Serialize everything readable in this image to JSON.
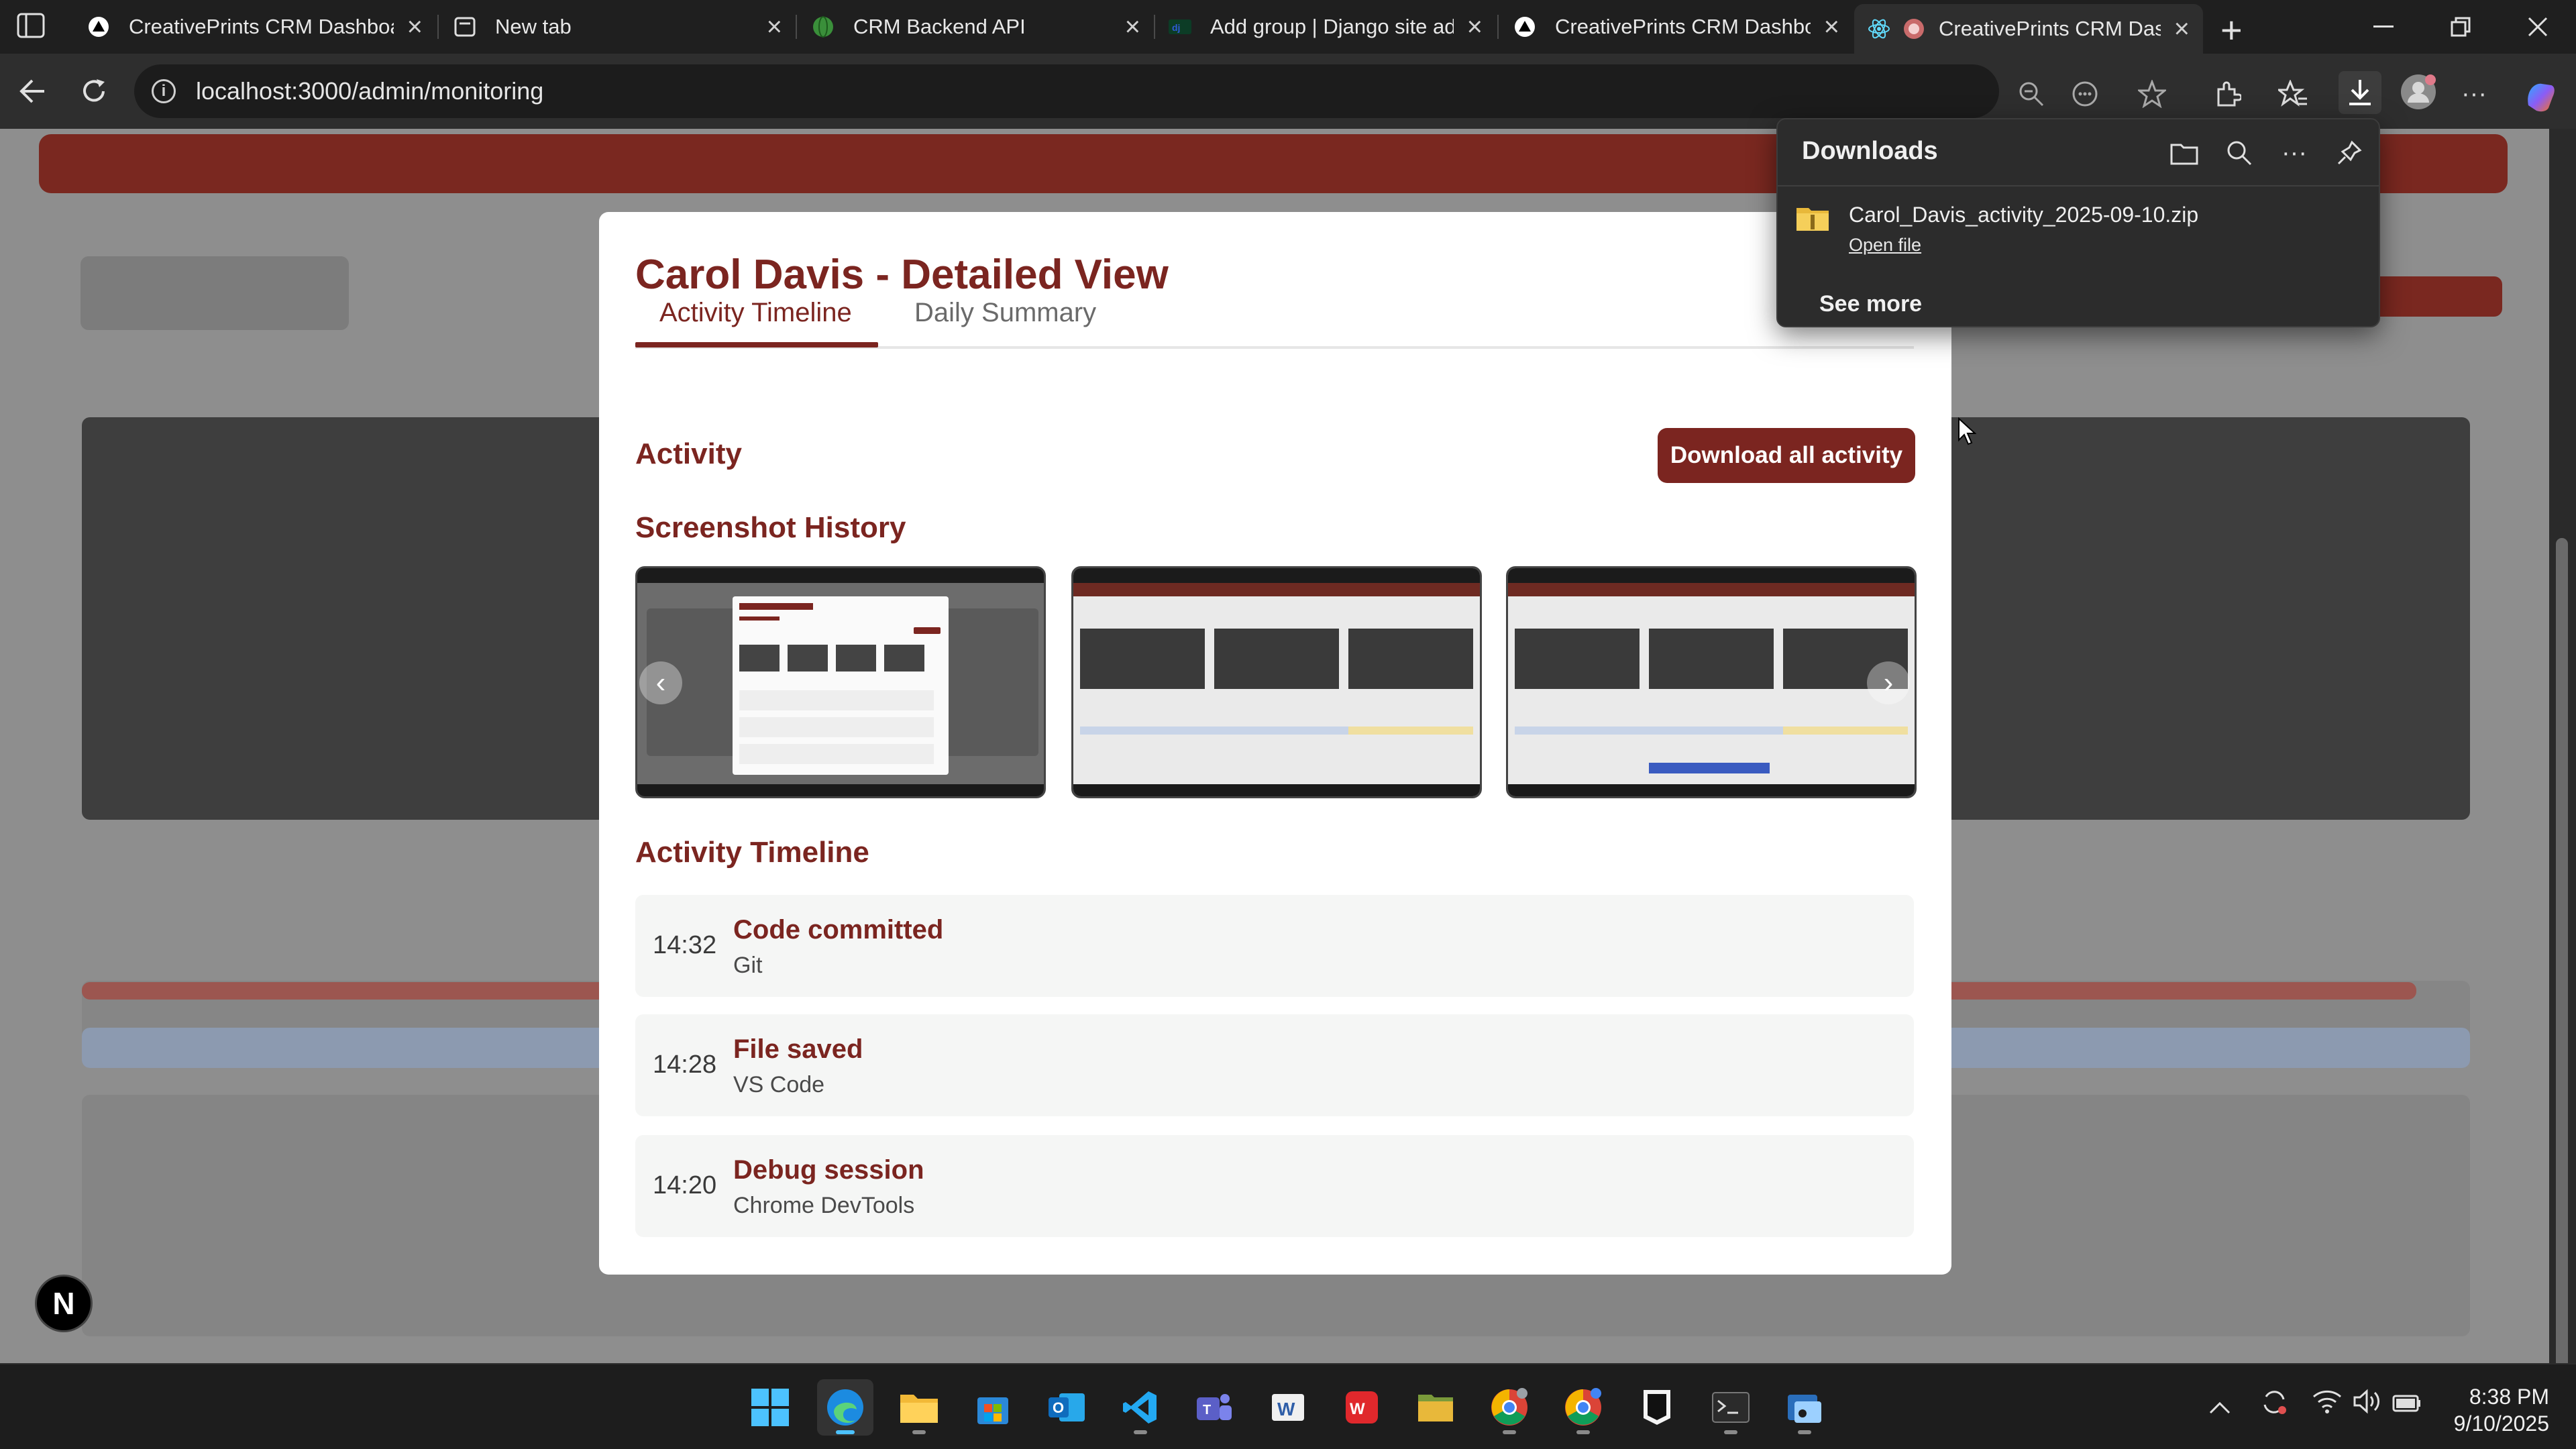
{
  "browser": {
    "tabs": [
      {
        "title": "CreativePrints CRM Dashboa",
        "icon": "triangle-logo-icon"
      },
      {
        "title": "New tab",
        "icon": "newtab-icon"
      },
      {
        "title": "CRM Backend API",
        "icon": "green-globe-icon"
      },
      {
        "title": "Add group | Django site adm",
        "icon": "django-icon"
      },
      {
        "title": "CreativePrints CRM Dashboa",
        "icon": "triangle-logo-icon"
      },
      {
        "title": "CreativePrints CRM Das",
        "icon": "react-icon",
        "active": true
      }
    ],
    "address": "localhost:3000/admin/monitoring"
  },
  "modal": {
    "title": "Carol Davis - Detailed View",
    "tabs": [
      {
        "label": "Activity Timeline",
        "active": true
      },
      {
        "label": "Daily Summary",
        "active": false
      }
    ],
    "activity_heading": "Activity",
    "download_button": "Download all activity",
    "screenshot_heading": "Screenshot History",
    "timeline_heading": "Activity Timeline",
    "timeline": [
      {
        "time": "14:32",
        "title": "Code committed",
        "source": "Git"
      },
      {
        "time": "14:28",
        "title": "File saved",
        "source": "VS Code"
      },
      {
        "time": "14:20",
        "title": "Debug session",
        "source": "Chrome DevTools"
      }
    ]
  },
  "downloads": {
    "heading": "Downloads",
    "file_name": "Carol_Davis_activity_2025-09-10.zip",
    "open_file": "Open file",
    "see_more": "See more"
  },
  "taskbar": {
    "time": "8:38 PM",
    "date": "9/10/2025"
  },
  "next_badge": "N",
  "colors": {
    "brand": "#7b2520",
    "modal_bg": "#ffffff",
    "timeline_card": "#f5f6f5"
  }
}
